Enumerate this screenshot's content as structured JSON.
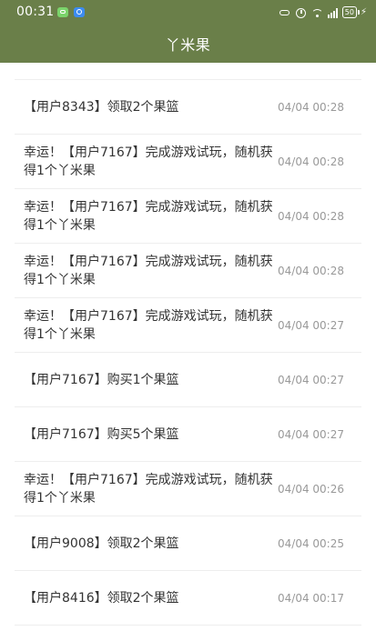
{
  "status_bar": {
    "time": "00:31",
    "battery": "50"
  },
  "header": {
    "title": "丫米果"
  },
  "records": [
    {
      "text": "【用户8343】领取2个果篮",
      "time": "04/04 00:28"
    },
    {
      "text": "幸运！【用户7167】完成游戏试玩，随机获得1个丫米果",
      "time": "04/04 00:28"
    },
    {
      "text": "幸运！【用户7167】完成游戏试玩，随机获得1个丫米果",
      "time": "04/04 00:28"
    },
    {
      "text": "幸运！【用户7167】完成游戏试玩，随机获得1个丫米果",
      "time": "04/04 00:28"
    },
    {
      "text": "幸运！【用户7167】完成游戏试玩，随机获得1个丫米果",
      "time": "04/04 00:27"
    },
    {
      "text": "【用户7167】购买1个果篮",
      "time": "04/04 00:27"
    },
    {
      "text": "【用户7167】购买5个果篮",
      "time": "04/04 00:27"
    },
    {
      "text": "幸运！【用户7167】完成游戏试玩，随机获得1个丫米果",
      "time": "04/04 00:26"
    },
    {
      "text": "【用户9008】领取2个果篮",
      "time": "04/04 00:25"
    },
    {
      "text": "【用户8416】领取2个果篮",
      "time": "04/04 00:17"
    }
  ]
}
